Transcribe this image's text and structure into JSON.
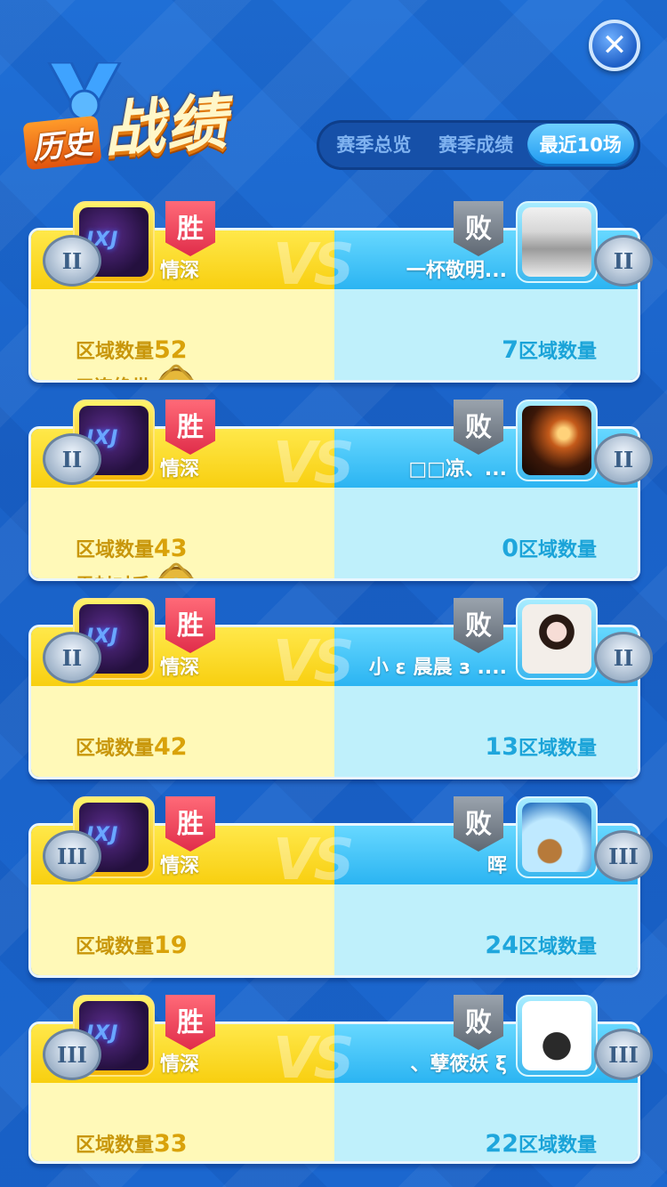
{
  "header": {
    "title_small": "历史",
    "title_big": "战绩",
    "close_icon": "close-icon",
    "tabs": [
      {
        "label": "赛季总览",
        "active": false
      },
      {
        "label": "赛季成绩",
        "active": false
      },
      {
        "label": "最近10场",
        "active": true
      }
    ]
  },
  "vs_label": "VS",
  "stat_label": "区域数量",
  "colors": {
    "win_band": "#f8cf10",
    "lose_band": "#2bb4f2",
    "win_tag": "#e02d4a",
    "lose_tag": "#5f6873"
  },
  "matches": [
    {
      "left": {
        "result": "胜",
        "name": "情深",
        "rank": "II",
        "count": "52",
        "achievement": "五连绝世"
      },
      "right": {
        "result": "败",
        "name": "一杯敬明...",
        "rank": "II",
        "count": "7"
      }
    },
    {
      "left": {
        "result": "胜",
        "name": "情深",
        "rank": "II",
        "count": "43",
        "achievement": "零封对手"
      },
      "right": {
        "result": "败",
        "name": "□□凉、...",
        "rank": "II",
        "count": "0"
      }
    },
    {
      "left": {
        "result": "胜",
        "name": "情深",
        "rank": "II",
        "count": "42",
        "achievement": ""
      },
      "right": {
        "result": "败",
        "name": "小 ε 晨晨 з ....",
        "rank": "II",
        "count": "13"
      }
    },
    {
      "left": {
        "result": "胜",
        "name": "情深",
        "rank": "III",
        "count": "19",
        "achievement": ""
      },
      "right": {
        "result": "败",
        "name": "晖",
        "rank": "III",
        "count": "24"
      }
    },
    {
      "left": {
        "result": "胜",
        "name": "情深",
        "rank": "III",
        "count": "33",
        "achievement": ""
      },
      "right": {
        "result": "败",
        "name": "、孽筱妖 ξ",
        "rank": "III",
        "count": "22"
      }
    }
  ]
}
